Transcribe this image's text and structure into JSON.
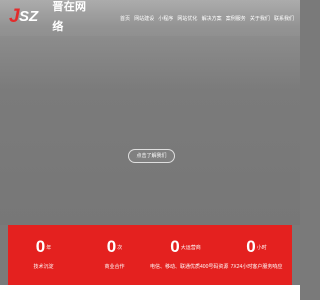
{
  "brand": {
    "mark_letter_1": "J",
    "mark_letter_2": "SZ",
    "name": "晋在网络"
  },
  "nav": [
    {
      "label": "首页"
    },
    {
      "label": "网站建设"
    },
    {
      "label": "小程序"
    },
    {
      "label": "网站优化"
    },
    {
      "label": "解决方案"
    },
    {
      "label": "案例服务"
    },
    {
      "label": "关于我们"
    },
    {
      "label": "联系我们"
    }
  ],
  "hero": {
    "cta_label": "点击了解我们"
  },
  "stats": [
    {
      "number": "0",
      "unit": "年",
      "label": "技术沉淀"
    },
    {
      "number": "0",
      "unit": "次",
      "label": "商业合作"
    },
    {
      "number": "0",
      "unit": "大运营商",
      "label": "电信、移动、联通优质400号码资源"
    },
    {
      "number": "0",
      "unit": "小时",
      "label": "7X24小时客户服务响应"
    }
  ],
  "colors": {
    "accent": "#e4211f",
    "hero_bg": "#7b7b7b",
    "text_light": "#ffffff"
  }
}
